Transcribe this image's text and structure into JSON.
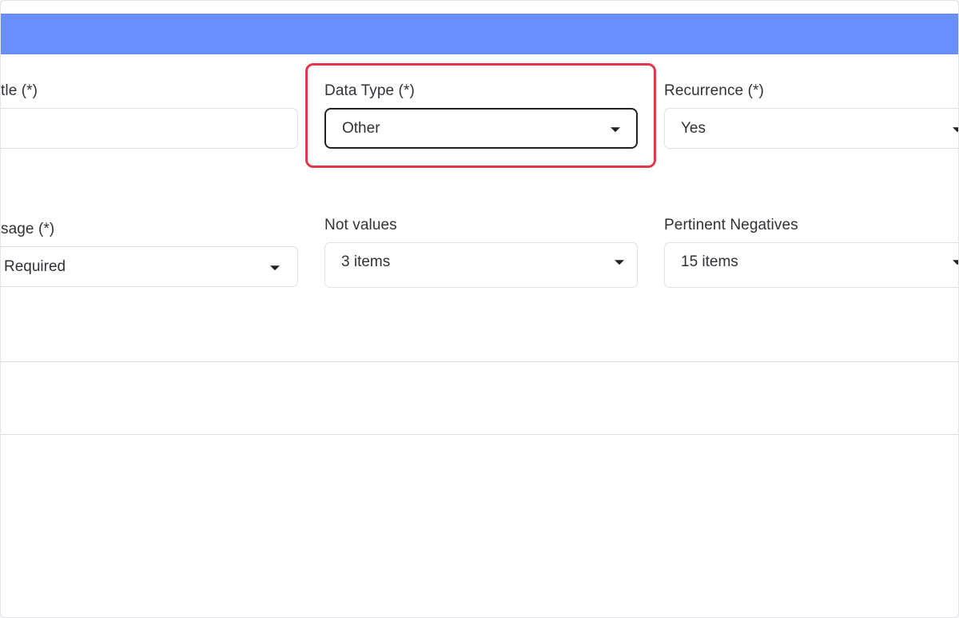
{
  "colors": {
    "header_bar": "#6a8ffd",
    "highlight": "#e0394c"
  },
  "form": {
    "title": {
      "label": "tle (*)",
      "value": ""
    },
    "data_type": {
      "label": "Data Type (*)",
      "value": "Other",
      "icon": "caret-down-icon"
    },
    "recurrence": {
      "label": "Recurrence (*)",
      "value": "Yes",
      "icon": "caret-down-icon"
    },
    "usage": {
      "label": "sage (*)",
      "value": "Required",
      "icon": "caret-down-icon"
    },
    "not_values": {
      "label": "Not values",
      "value": "3 items",
      "icon": "caret-down-icon"
    },
    "pertinent_negatives": {
      "label": "Pertinent Negatives",
      "value": "15 items",
      "icon": "caret-down-icon"
    }
  }
}
